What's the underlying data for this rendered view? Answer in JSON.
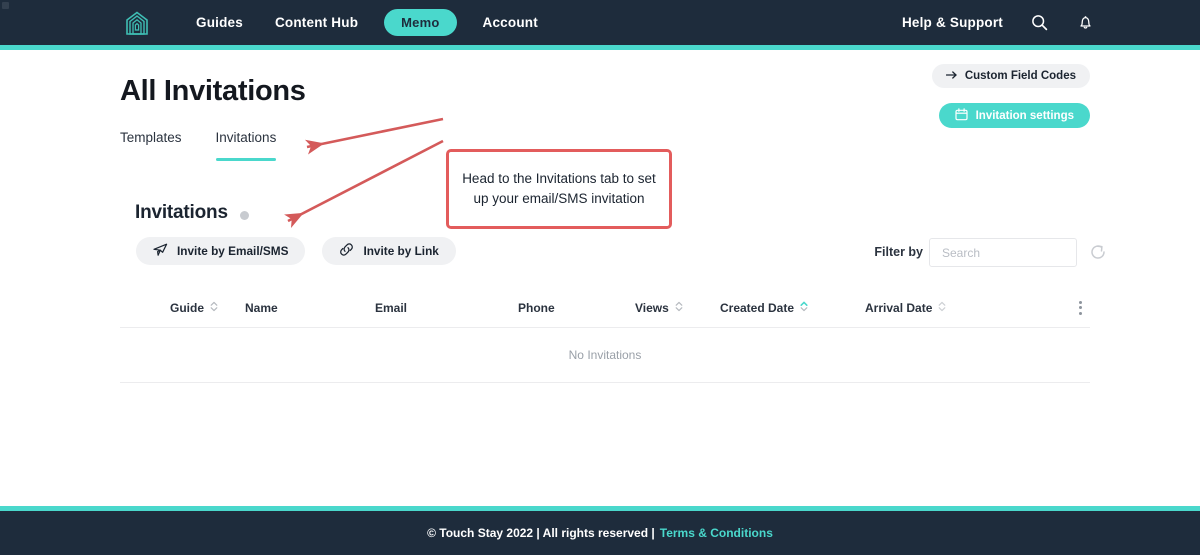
{
  "navbar": {
    "logo_icon": "home-logo-icon",
    "links": [
      {
        "label": "Guides",
        "active": false
      },
      {
        "label": "Content Hub",
        "active": false
      },
      {
        "label": "Memo",
        "active": true
      },
      {
        "label": "Account",
        "active": false
      }
    ],
    "help_label": "Help & Support",
    "search_icon": "search-icon",
    "notification_icon": "bell-icon",
    "bg_color": "#1e2c3c",
    "accent_color": "#4ad8cc"
  },
  "header": {
    "title": "All Invitations",
    "tabs": [
      {
        "label": "Templates",
        "active": false
      },
      {
        "label": "Invitations",
        "active": true
      }
    ],
    "custom_field_codes": {
      "label": "Custom Field Codes",
      "icon": "arrow-right-icon"
    },
    "invitation_settings": {
      "label": "Invitation settings",
      "icon": "calendar-icon",
      "color": "#4ad8cc"
    }
  },
  "section": {
    "title": "Invitations",
    "info_icon": "info-dot-icon",
    "buttons": [
      {
        "label": "Invite by Email/SMS",
        "icon": "paper-plane-icon"
      },
      {
        "label": "Invite by Link",
        "icon": "link-icon"
      }
    ]
  },
  "toolbar": {
    "filter_label": "Filter by",
    "filter_icon": "chevron-down-icon",
    "search_placeholder": "Search",
    "search_value": "",
    "refresh_icon": "refresh-icon"
  },
  "table": {
    "columns": [
      {
        "label": "Guide",
        "sortable": true,
        "sort_state": "none"
      },
      {
        "label": "Name",
        "sortable": false,
        "sort_state": "none"
      },
      {
        "label": "Email",
        "sortable": false,
        "sort_state": "none"
      },
      {
        "label": "Phone",
        "sortable": false,
        "sort_state": "none"
      },
      {
        "label": "Views",
        "sortable": true,
        "sort_state": "none"
      },
      {
        "label": "Created Date",
        "sortable": true,
        "sort_state": "asc"
      },
      {
        "label": "Arrival Date",
        "sortable": true,
        "sort_state": "none"
      }
    ],
    "rows": [],
    "empty_message": "No Invitations",
    "row_menu_icon": "kebab-menu-icon"
  },
  "annotation": {
    "text": "Head to the Invitations tab to set up your email/SMS invitation",
    "border_color": "#e35c5c",
    "arrow_color": "#d45a5a"
  },
  "footer": {
    "copyright": "© Touch Stay 2022 | All rights reserved |",
    "link_label": "Terms & Conditions",
    "link_color": "#4ad8cc"
  }
}
